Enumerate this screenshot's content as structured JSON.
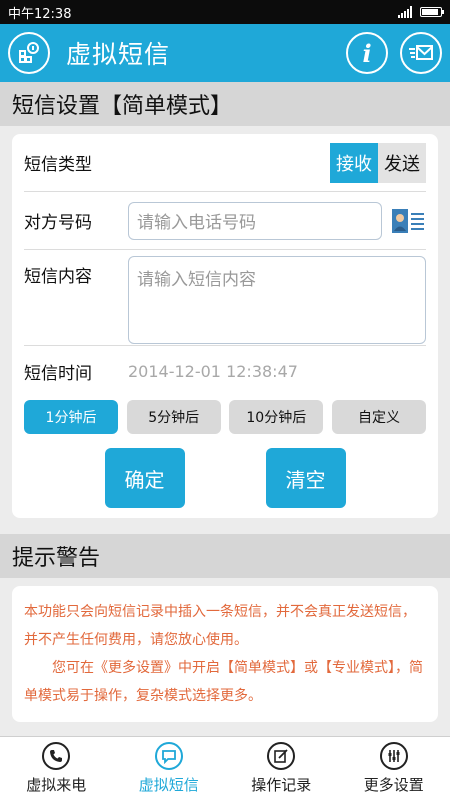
{
  "status_bar": {
    "left_text": "中午12:38"
  },
  "app_bar": {
    "title": "虚拟短信",
    "info_icon": "info-icon",
    "message_icon": "message-icon",
    "menu_icon": "grid-icon"
  },
  "settings_section": {
    "title": "短信设置【简单模式】"
  },
  "form": {
    "type_label": "短信类型",
    "type_options": [
      "接收",
      "发送"
    ],
    "type_selected": "接收",
    "number_label": "对方号码",
    "number_placeholder": "请输入电话号码",
    "content_label": "短信内容",
    "content_placeholder": "请输入短信内容",
    "time_label": "短信时间",
    "time_value": "2014-12-01 12:38:47",
    "delay_options": [
      "1分钟后",
      "5分钟后",
      "10分钟后",
      "自定义"
    ],
    "delay_selected": "1分钟后",
    "confirm_label": "确定",
    "clear_label": "清空"
  },
  "warning_section": {
    "title": "提示警告",
    "para1": "本功能只会向短信记录中插入一条短信，并不会真正发送短信，并不产生任何费用，请您放心使用。",
    "para2": "您可在《更多设置》中开启【简单模式】或【专业模式】，简单模式易于操作，复杂模式选择更多。"
  },
  "bottom_nav": {
    "items": [
      {
        "label": "虚拟来电",
        "icon": "phone-icon"
      },
      {
        "label": "虚拟短信",
        "icon": "sms-icon"
      },
      {
        "label": "操作记录",
        "icon": "edit-icon"
      },
      {
        "label": "更多设置",
        "icon": "settings-icon"
      }
    ],
    "active": "虚拟短信"
  },
  "colors": {
    "accent": "#1fa8d8",
    "warning_text": "#e2693c",
    "header_bg": "#d6d6d6"
  }
}
